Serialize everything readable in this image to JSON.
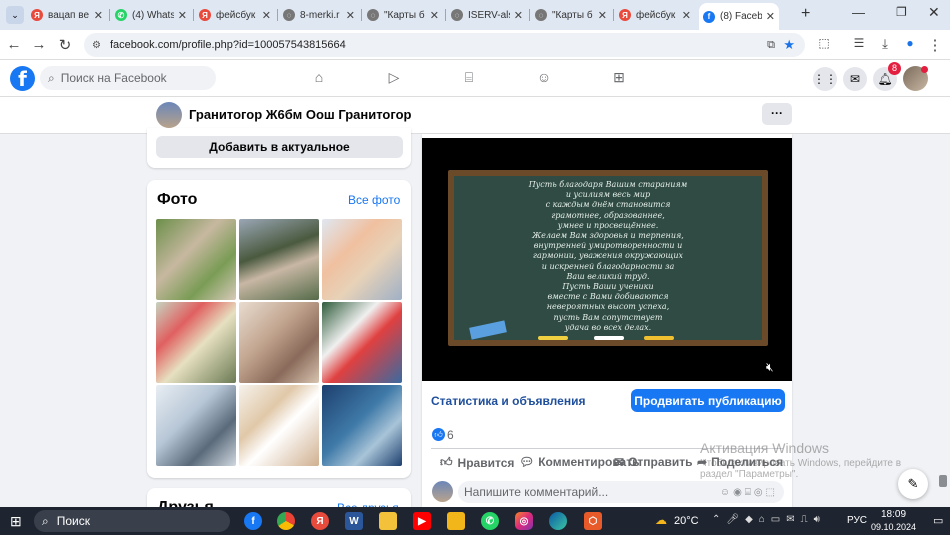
{
  "browser": {
    "tabs": [
      {
        "title": "вацап ве",
        "icon": "yandex-icon",
        "color": "#e84a3c"
      },
      {
        "title": "(4) Whats",
        "icon": "whatsapp-icon",
        "color": "#25d366"
      },
      {
        "title": "фейсбук -",
        "icon": "yandex-icon",
        "color": "#e84a3c"
      },
      {
        "title": "8-merki.r",
        "icon": "globe-icon",
        "color": "#777777"
      },
      {
        "title": "\"Карты б",
        "icon": "globe-icon",
        "color": "#777777"
      },
      {
        "title": "ISERV-als",
        "icon": "globe-icon",
        "color": "#777777"
      },
      {
        "title": "\"Карты б",
        "icon": "globe-icon",
        "color": "#777777"
      },
      {
        "title": "фейсбук -",
        "icon": "yandex-icon",
        "color": "#e84a3c"
      },
      {
        "title": "(8) Faceb",
        "icon": "facebook-icon",
        "color": "#1877f2"
      }
    ],
    "url": "facebook.com/profile.php?id=100057543815664"
  },
  "facebook": {
    "search_placeholder": "Поиск на Facebook",
    "notifications_count": "8"
  },
  "page": {
    "name": "Гранитогор Ж6бм Оош Гранитогор",
    "more_label": "···"
  },
  "left": {
    "add_featured": "Добавить в актуальное",
    "photos_title": "Фото",
    "all_photos": "Все фото",
    "friends_title": "Друзья",
    "all_friends": "Все друзья"
  },
  "post": {
    "video_text": "Пусть благодаря Вашим стараниям\nи усилиям весь мир\nс каждым днём становится\nграмотнее, образованнее,\nумнее и просвещённее.\nЖелаем Вам здоровья и терпения,\nвнутренней умиротворенности и\nгармонии, уважения окружающих\nи искренней благодарности за\nВаш великий труд.\nПусть Ваши ученики\nвместе с Вами добиваются\nневероятных высот успеха,\nпусть Вам сопутствует\nудача во всех делах.",
    "stats_label": "Статистика и объявления",
    "promote_label": "Продвигать публикацию",
    "likes_count": "6",
    "like_label": "Нравится",
    "comment_label": "Комментировать",
    "share_label": "Отправить",
    "repost_label": "Поделиться",
    "comment_placeholder": "Напишите комментарий..."
  },
  "watermark": {
    "line1": "Активация Windows",
    "line2": "Чтобы активировать Windows, перейдите в",
    "line3": "раздел \"Параметры\"."
  },
  "taskbar": {
    "search_label": "Поиск",
    "weather": "20°C",
    "lang": "РУС",
    "time": "18:09",
    "date": "09.10.2024"
  }
}
